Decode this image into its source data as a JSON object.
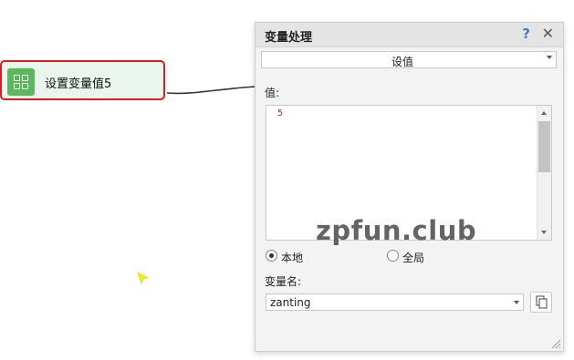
{
  "node": {
    "label": "设置变量值5",
    "icon": "grid-icon"
  },
  "panel": {
    "title": "变量处理",
    "help_icon": "?",
    "close_icon": "✕",
    "mode": "设值",
    "value_label": "值:",
    "value_content": "5",
    "scope_local": "本地",
    "scope_global": "全局",
    "scope_selected": "本地",
    "varname_label": "变量名:",
    "varname_value": "zanting"
  },
  "watermark": "zpfun.club",
  "colors": {
    "node_border": "#d81f1f",
    "node_bg": "#eaf5ee",
    "icon_green": "#5cb85c",
    "help_blue": "#3b7fd1"
  }
}
